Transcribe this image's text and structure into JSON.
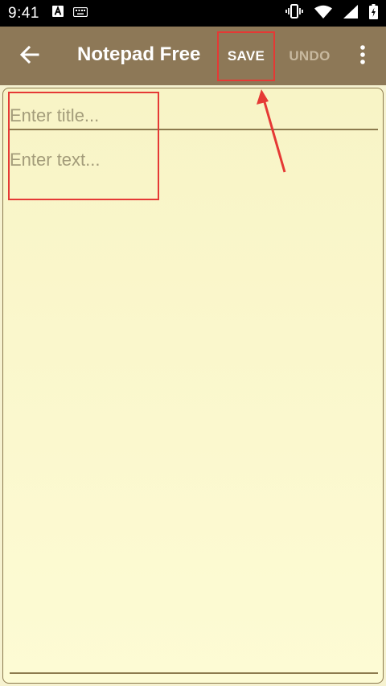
{
  "status_bar": {
    "time": "9:41",
    "icons": [
      "notification-a-icon",
      "keyboard-icon",
      "vibrate-icon",
      "wifi-icon",
      "signal-icon",
      "battery-charging-icon"
    ]
  },
  "app_bar": {
    "title": "Notepad Free",
    "save_label": "SAVE",
    "undo_label": "UNDO",
    "icons": [
      "back-arrow-icon",
      "overflow-menu-icon"
    ]
  },
  "editor": {
    "title_placeholder": "Enter title...",
    "title_value": "",
    "text_placeholder": "Enter text...",
    "text_value": ""
  },
  "colors": {
    "app_bar": "#8d7857",
    "paper": "#fbf8cf",
    "annotation": "#e53935",
    "undo_disabled": "#c7b89e"
  }
}
